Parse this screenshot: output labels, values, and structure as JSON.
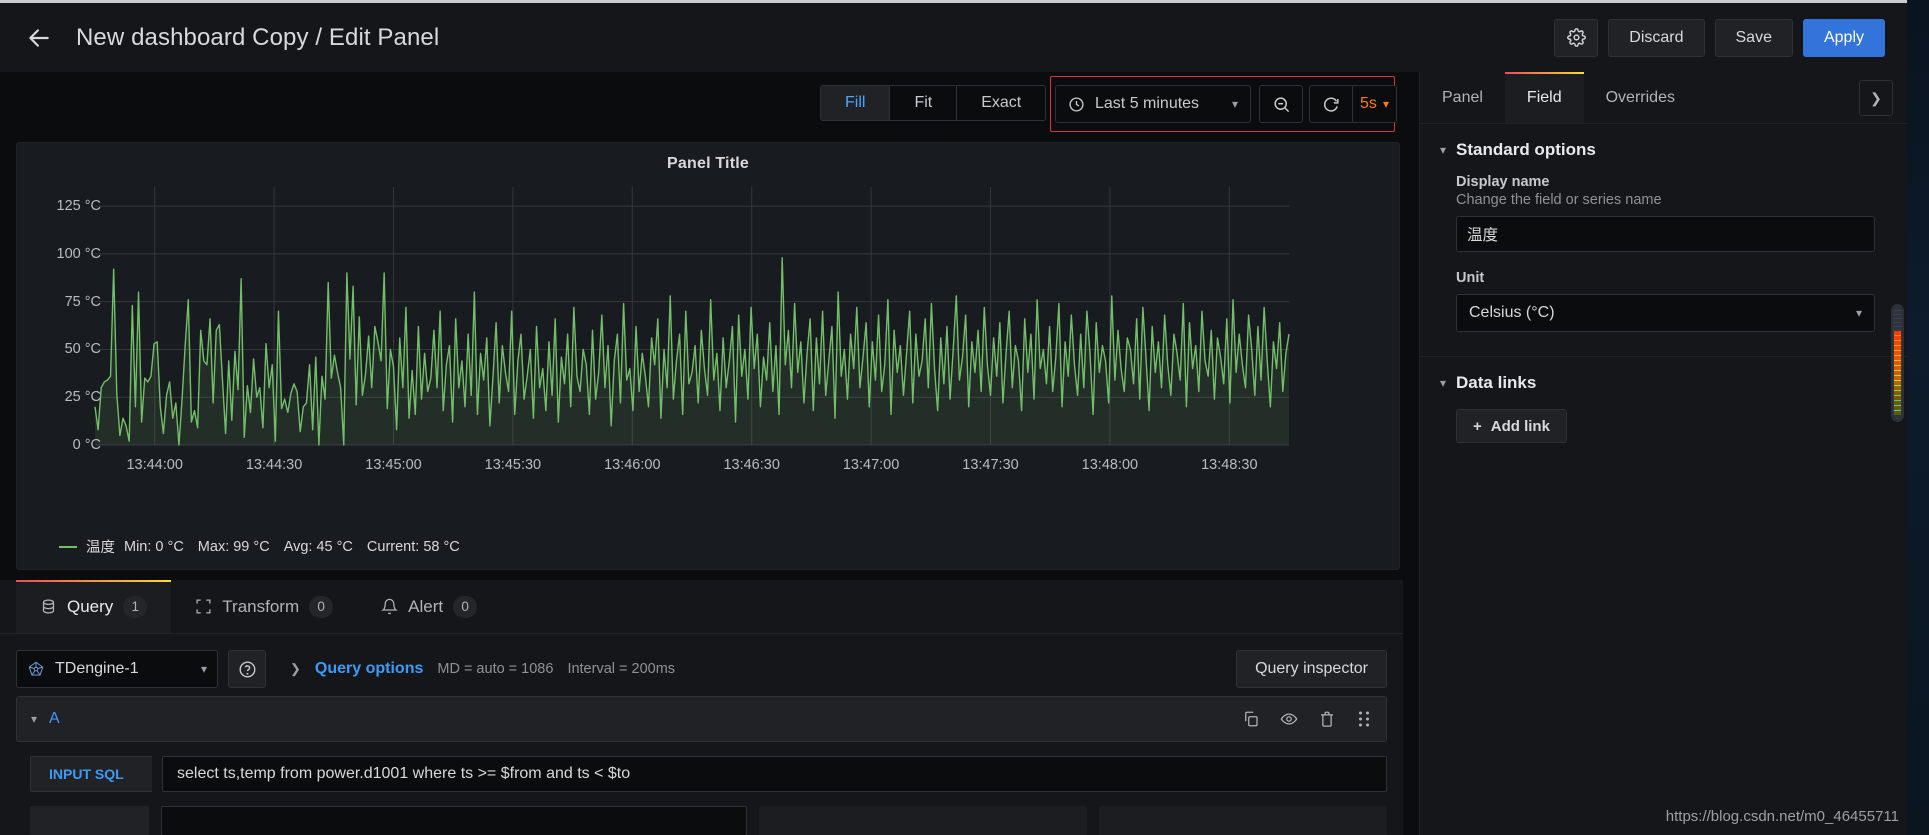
{
  "header": {
    "back_icon": "arrow-left-icon",
    "title": "New dashboard Copy / Edit Panel",
    "settings_icon": "gear-icon",
    "discard_label": "Discard",
    "save_label": "Save",
    "apply_label": "Apply",
    "accent_primary": "#3274d9"
  },
  "toolbar": {
    "size_options": [
      {
        "label": "Fill",
        "active": true
      },
      {
        "label": "Fit",
        "active": false
      },
      {
        "label": "Exact",
        "active": false
      }
    ],
    "time_icon": "clock-icon",
    "time_range": "Last 5 minutes",
    "zoom_out_icon": "zoom-out-icon",
    "refresh_icon": "refresh-icon",
    "refresh_interval": "5s",
    "highlight_color": "#e02f44",
    "interval_color": "#ff780a"
  },
  "options_pane": {
    "tabs": [
      {
        "label": "Panel",
        "active": false
      },
      {
        "label": "Field",
        "active": true
      },
      {
        "label": "Overrides",
        "active": false
      }
    ],
    "collapse_icon": "chevron-right-icon",
    "sections": [
      {
        "title": "Standard options",
        "caret_icon": "chevron-down-icon",
        "fields": [
          {
            "label": "Display name",
            "description": "Change the field or series name",
            "value": "温度",
            "type": "text"
          },
          {
            "label": "Unit",
            "description": "",
            "value": "Celsius (°C)",
            "type": "select"
          }
        ]
      },
      {
        "title": "Data links",
        "caret_icon": "chevron-down-icon",
        "add_link_label": "Add link",
        "add_link_icon": "plus-icon"
      }
    ]
  },
  "panel": {
    "title": "Panel Title",
    "series_color": "#73bf69",
    "legend": {
      "name": "温度",
      "stats": [
        "Min: 0 °C",
        "Max: 99 °C",
        "Avg: 45 °C",
        "Current: 58 °C"
      ]
    }
  },
  "chart_data": {
    "type": "line",
    "title": "Panel Title",
    "xlabel": "",
    "ylabel": "",
    "unit": "°C",
    "grid": true,
    "legend_position": "bottom-left",
    "ylim": [
      0,
      135
    ],
    "yticks": [
      0,
      25,
      50,
      75,
      100,
      125
    ],
    "ytick_labels": [
      "0 °C",
      "25 °C",
      "50 °C",
      "75 °C",
      "100 °C",
      "125 °C"
    ],
    "xticks": [
      "13:44:00",
      "13:44:30",
      "13:45:00",
      "13:45:30",
      "13:46:00",
      "13:46:30",
      "13:47:00",
      "13:47:30",
      "13:48:00",
      "13:48:30"
    ],
    "series": [
      {
        "name": "温度",
        "color": "#73bf69",
        "fill": true,
        "stats": {
          "min": 0,
          "max": 99,
          "avg": 45,
          "current": 58
        },
        "values": [
          20,
          8,
          30,
          33,
          34,
          36,
          92,
          27,
          5,
          14,
          10,
          2,
          73,
          20,
          80,
          12,
          35,
          33,
          36,
          53,
          54,
          20,
          6,
          26,
          33,
          14,
          22,
          0,
          24,
          52,
          76,
          12,
          18,
          9,
          60,
          44,
          42,
          66,
          22,
          60,
          63,
          34,
          6,
          44,
          13,
          49,
          29,
          87,
          4,
          31,
          17,
          45,
          25,
          30,
          9,
          53,
          30,
          42,
          2,
          70,
          19,
          24,
          17,
          27,
          32,
          28,
          7,
          20,
          22,
          42,
          8,
          46,
          0,
          36,
          24,
          85,
          35,
          47,
          38,
          30,
          0,
          90,
          45,
          83,
          21,
          67,
          26,
          37,
          57,
          30,
          62,
          54,
          44,
          90,
          19,
          50,
          41,
          8,
          56,
          30,
          72,
          14,
          39,
          16,
          62,
          24,
          48,
          28,
          35,
          60,
          30,
          70,
          18,
          42,
          52,
          12,
          66,
          30,
          44,
          20,
          58,
          26,
          80,
          16,
          48,
          34,
          56,
          10,
          36,
          64,
          22,
          52,
          38,
          28,
          70,
          16,
          44,
          58,
          24,
          36,
          50,
          14,
          62,
          30,
          40,
          18,
          54,
          26,
          66,
          12,
          46,
          32,
          58,
          20,
          72,
          36,
          28,
          50,
          42,
          16,
          60,
          24,
          38,
          68,
          30,
          52,
          10,
          44,
          58,
          22,
          74,
          34,
          40,
          18,
          62,
          28,
          48,
          36,
          20,
          56,
          42,
          66,
          14,
          50,
          30,
          78,
          24,
          44,
          58,
          16,
          70,
          32,
          38,
          52,
          22,
          60,
          40,
          26,
          76,
          34,
          48,
          18,
          56,
          30,
          44,
          62,
          12,
          68,
          36,
          50,
          24,
          72,
          40,
          58,
          20,
          46,
          34,
          64,
          28,
          52,
          16,
          98,
          42,
          60,
          30,
          74,
          38,
          54,
          22,
          48,
          66,
          18,
          56,
          32,
          70,
          26,
          44,
          62,
          14,
          80,
          36,
          50,
          24,
          58,
          40,
          72,
          30,
          46,
          64,
          20,
          54,
          34,
          68,
          28,
          42,
          76,
          16,
          60,
          38,
          52,
          26,
          48,
          70,
          22,
          58,
          36,
          44,
          66,
          30,
          74,
          40,
          18,
          56,
          32,
          62,
          24,
          50,
          78,
          34,
          46,
          68,
          20,
          54,
          38,
          60,
          28,
          72,
          42,
          26,
          56,
          36,
          64,
          22,
          48,
          70,
          30,
          52,
          44,
          18,
          66,
          38,
          58,
          24,
          76,
          40,
          50,
          32,
          62,
          28,
          46,
          74,
          20,
          54,
          36,
          68,
          42,
          26,
          58,
          30,
          70,
          48,
          16,
          64,
          38,
          52,
          44,
          22,
          78,
          34,
          60,
          40,
          28,
          56,
          50,
          32,
          66,
          24,
          72,
          46,
          18,
          62,
          38,
          54,
          30,
          68,
          42,
          26,
          58,
          48,
          34,
          74,
          20,
          64,
          40,
          52,
          28,
          70,
          44,
          36,
          60,
          24,
          56,
          46,
          32,
          66,
          22,
          76,
          38,
          58,
          42,
          30,
          68,
          50,
          26,
          62,
          34,
          72,
          44,
          20,
          54,
          40,
          64,
          28,
          48,
          58
        ]
      }
    ]
  },
  "editor": {
    "tabs": [
      {
        "label": "Query",
        "badge": "1",
        "icon": "database-icon",
        "active": true
      },
      {
        "label": "Transform",
        "badge": "0",
        "icon": "transform-icon",
        "active": false
      },
      {
        "label": "Alert",
        "badge": "0",
        "icon": "bell-icon",
        "active": false
      }
    ],
    "datasource": {
      "name": "TDengine-1",
      "icon": "datasource-icon",
      "help_icon": "question-circle-icon"
    },
    "query_options": {
      "caret_icon": "chevron-right-icon",
      "title": "Query options",
      "max_data_points": "MD = auto = 1086",
      "interval": "Interval = 200ms"
    },
    "query_inspector_label": "Query inspector",
    "query_row": {
      "caret_icon": "chevron-down-icon",
      "name": "A",
      "icons": [
        "copy-icon",
        "eye-icon",
        "trash-icon",
        "drag-handle-icon"
      ]
    },
    "sql": {
      "label": "INPUT SQL",
      "value": "select  ts,temp from power.d1001 where ts >= $from and ts < $to"
    }
  },
  "watermark": "https://blog.csdn.net/m0_46455711"
}
